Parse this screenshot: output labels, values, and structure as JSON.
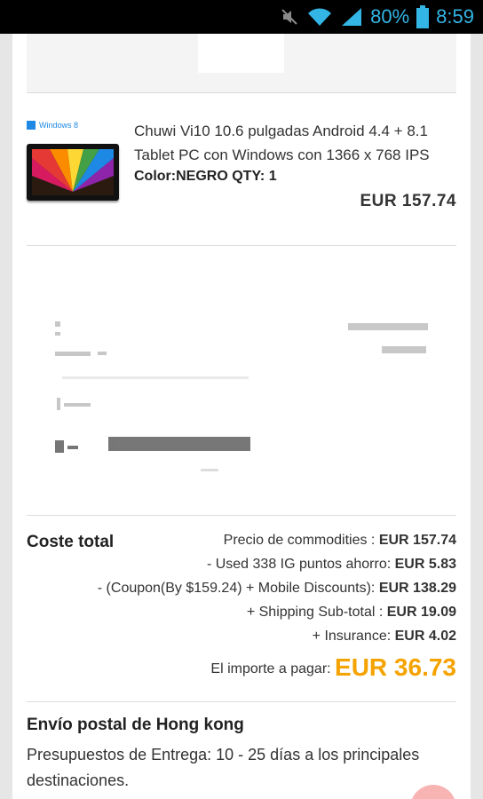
{
  "status_bar": {
    "battery": "80%",
    "time": "8:59"
  },
  "product": {
    "os_badge": "Windows 8",
    "title": "Chuwi Vi10 10.6 pulgadas Android 4.4 + 8.1 Tablet PC con Windows con 1366 x 768 IPS",
    "color_qty": "Color:NEGRO   QTY: 1",
    "price": "EUR  157.74"
  },
  "totals": {
    "label": "Coste total",
    "rows": [
      {
        "text": "Precio de commodities : ",
        "amount": "EUR   157.74"
      },
      {
        "text": "- Used 338 IG puntos ahorro: ",
        "amount": "EUR   5.83"
      },
      {
        "text": "- (Coupon(By $159.24) + Mobile Discounts): ",
        "amount": "EUR   138.29"
      },
      {
        "text": "+ Shipping Sub-total : ",
        "amount": "EUR   19.09"
      },
      {
        "text": "+ Insurance: ",
        "amount": "EUR   4.02"
      }
    ],
    "pay_label": "El importe a pagar: ",
    "pay_amount": "EUR  36.73"
  },
  "shipping": {
    "title": "Envío postal de Hong kong",
    "text": "Presupuestos de Entrega: 10 - 25 días a los principales destinaciones."
  },
  "colors": {
    "accent_orange": "#f4a300",
    "status_blue": "#33b5e5"
  }
}
